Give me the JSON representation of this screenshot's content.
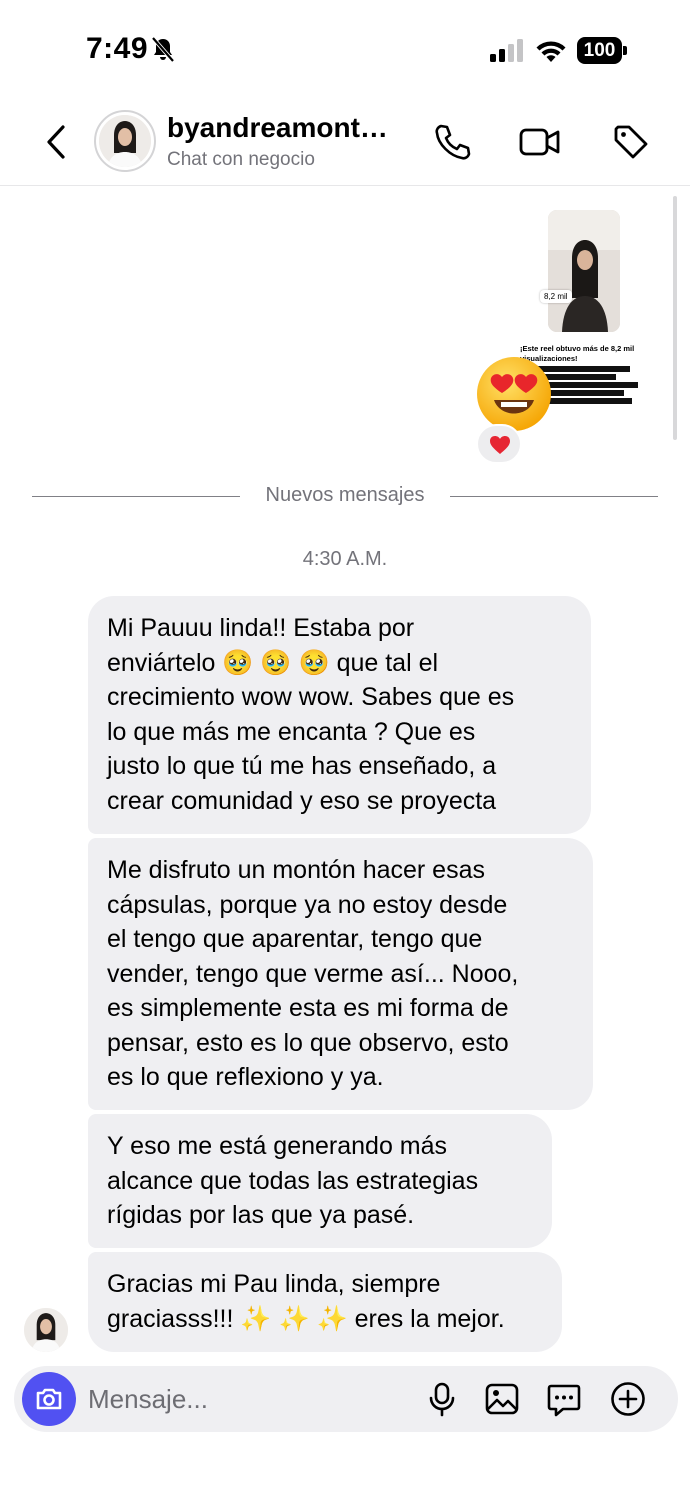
{
  "status_bar": {
    "time": "7:49",
    "battery": "100"
  },
  "header": {
    "name": "byandreamont…",
    "subtitle": "Chat con negocio"
  },
  "shared_reel": {
    "views_badge": "8,2 mil",
    "caption": "¡Este reel obtuvo más de 8,2 mil visualizaciones!",
    "reaction_emoji": "😍",
    "reaction_emoji_name": "heart-eyes",
    "reaction_pill_name": "red-heart"
  },
  "divider": {
    "label": "Nuevos mensajes"
  },
  "timestamp": "4:30 A.M.",
  "messages": [
    {
      "lines": [
        "Mi Pauuu linda!! Estaba por",
        "enviártelo 🥹 🥹 🥹  que tal el",
        "crecimiento wow wow. Sabes que es",
        "lo que más me encanta ? Que es",
        "justo lo que tú me has enseñado, a",
        "crear comunidad y eso se proyecta"
      ]
    },
    {
      "lines": [
        "Me disfruto un montón hacer esas",
        "cápsulas, porque ya no estoy desde",
        "el tengo que aparentar, tengo que",
        "vender, tengo que verme así... Nooo,",
        "es simplemente esta es mi forma de",
        "pensar, esto es lo que observo, esto",
        "es lo que reflexiono y ya."
      ]
    },
    {
      "lines": [
        "Y eso me está generando más",
        "alcance que todas las estrategias",
        "rígidas por las que ya pasé."
      ]
    },
    {
      "lines": [
        "Gracias mi Pau linda, siempre",
        "graciasss!!! ✨ ✨ ✨  eres la mejor."
      ]
    }
  ],
  "composer": {
    "placeholder": "Mensaje..."
  },
  "colors": {
    "bubble": "#efeff2",
    "camera_button": "#5151f2",
    "secondary_text": "#73737a"
  }
}
